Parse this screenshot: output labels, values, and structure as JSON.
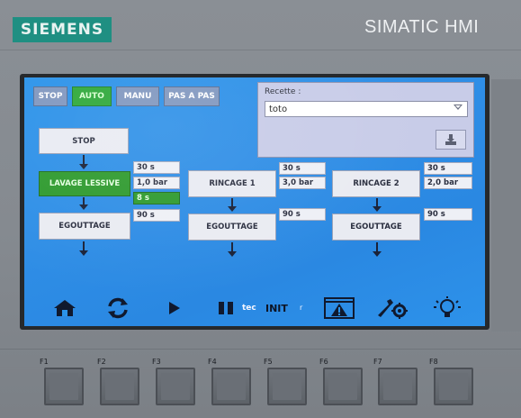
{
  "device": {
    "brand": "SIEMENS",
    "model": "SIMATIC HMI",
    "side_text": ""
  },
  "mode_buttons": [
    {
      "label": "STOP",
      "active": false
    },
    {
      "label": "AUTO",
      "active": true
    },
    {
      "label": "MANU",
      "active": false
    },
    {
      "label": "PAS A PAS",
      "active": false
    }
  ],
  "recipe": {
    "label": "Recette :",
    "selected": "toto"
  },
  "sequence": {
    "stop": "STOP",
    "washing": {
      "name": "LAVAGE LESSIVE",
      "time": "30 s",
      "pressure": "1,0 bar",
      "elapsed": "8 s",
      "drain": "EGOUTTAGE",
      "drain_time": "90 s"
    },
    "rinse1": {
      "name": "RINCAGE 1",
      "time": "30 s",
      "pressure": "3,0 bar",
      "drain": "EGOUTTAGE",
      "drain_time": "90 s"
    },
    "rinse2": {
      "name": "RINCAGE 2",
      "time": "30 s",
      "pressure": "2,0 bar",
      "drain": "EGOUTTAGE",
      "drain_time": "90 s"
    }
  },
  "toolbar": {
    "tec_text": "tec",
    "init_label": "INIT",
    "r_text": "r",
    "icons": [
      "home-icon",
      "refresh-icon",
      "play-icon",
      "pause-icon",
      "alarm-icon",
      "settings-icon",
      "lightbulb-icon"
    ]
  },
  "function_keys": [
    "F1",
    "F2",
    "F3",
    "F4",
    "F5",
    "F6",
    "F7",
    "F8"
  ],
  "colors": {
    "screen": "#2b93ea",
    "active_green": "#2e9a2e",
    "brand_teal": "#1f8f82",
    "mode_button": "#8097bf",
    "recipe_panel": "#c8cce8"
  }
}
